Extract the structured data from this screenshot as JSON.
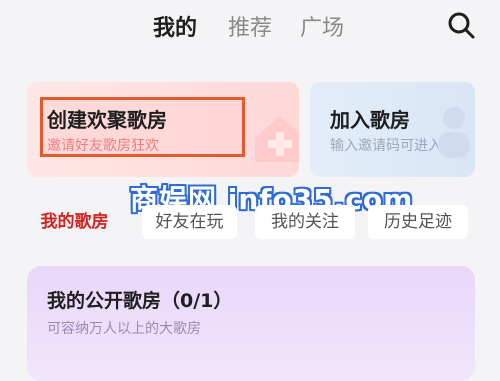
{
  "nav": {
    "tabs": [
      {
        "label": "我的",
        "active": true
      },
      {
        "label": "推荐",
        "active": false
      },
      {
        "label": "广场",
        "active": false
      }
    ],
    "search_icon": "search-icon"
  },
  "create_room": {
    "title": "创建欢聚歌房",
    "subtitle": "邀请好友歌房狂欢",
    "highlight_color": "#e25b2e"
  },
  "join_room": {
    "title": "加入歌房",
    "subtitle": "输入邀请码可进入"
  },
  "watermark": {
    "text": "商娱网 info35.com"
  },
  "subtabs": [
    {
      "label": "我的歌房",
      "active": true
    },
    {
      "label": "好友在玩",
      "active": false
    },
    {
      "label": "我的关注",
      "active": false
    },
    {
      "label": "历史足迹",
      "active": false
    }
  ],
  "public_room": {
    "title": "我的公开歌房（0/1）",
    "subtitle": "可容纳万人以上的大歌房"
  },
  "colors": {
    "accent_red": "#d1241f",
    "watermark_blue": "#2f6cd8"
  }
}
